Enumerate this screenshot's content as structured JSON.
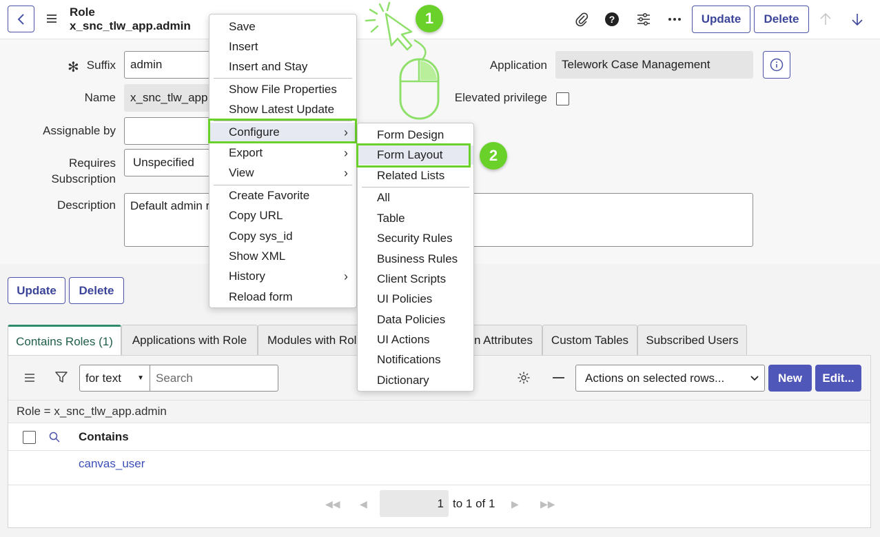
{
  "header": {
    "title": "Role",
    "subtitle": "x_snc_tlw_app.admin",
    "update_label": "Update",
    "delete_label": "Delete"
  },
  "form": {
    "suffix_label": "Suffix",
    "suffix_value": "admin",
    "name_label": "Name",
    "name_value": "x_snc_tlw_app.a",
    "assignable_label": "Assignable by",
    "requires_label_1": "Requires",
    "requires_label_2": "Subscription",
    "requires_value": "Unspecified",
    "description_label": "Description",
    "description_value": "Default admin r",
    "application_label": "Application",
    "application_value": "Telework Case Management",
    "elevated_label": "Elevated privilege",
    "update_label": "Update",
    "delete_label": "Delete"
  },
  "tabs": [
    {
      "label": "Contains Roles (1)"
    },
    {
      "label": "Applications with Role"
    },
    {
      "label": "Modules with Rol"
    },
    {
      "label": "n Attributes"
    },
    {
      "label": "Custom Tables"
    },
    {
      "label": "Subscribed Users"
    }
  ],
  "list": {
    "search_field": "for text",
    "search_placeholder": "Search",
    "actions_select": "Actions on selected rows...",
    "new_label": "New",
    "edit_label": "Edit...",
    "filter_text": "Role = x_snc_tlw_app.admin",
    "column_header": "Contains",
    "rows": [
      {
        "value": "canvas_user"
      }
    ],
    "page_current": "1",
    "page_range": "to 1 of 1"
  },
  "context_menu": {
    "items": [
      {
        "label": "Save"
      },
      {
        "label": "Insert"
      },
      {
        "label": "Insert and Stay"
      },
      {
        "label": "Show File Properties"
      },
      {
        "label": "Show Latest Update"
      },
      {
        "label": "Configure"
      },
      {
        "label": "Export"
      },
      {
        "label": "View"
      },
      {
        "label": "Create Favorite"
      },
      {
        "label": "Copy URL"
      },
      {
        "label": "Copy sys_id"
      },
      {
        "label": "Show XML"
      },
      {
        "label": "History"
      },
      {
        "label": "Reload form"
      }
    ]
  },
  "submenu": {
    "items": [
      {
        "label": "Form Design"
      },
      {
        "label": "Form Layout"
      },
      {
        "label": "Related Lists"
      },
      {
        "label": "All"
      },
      {
        "label": "Table"
      },
      {
        "label": "Security Rules"
      },
      {
        "label": "Business Rules"
      },
      {
        "label": "Client Scripts"
      },
      {
        "label": "UI Policies"
      },
      {
        "label": "Data Policies"
      },
      {
        "label": "UI Actions"
      },
      {
        "label": "Notifications"
      },
      {
        "label": "Dictionary"
      }
    ]
  },
  "annotations": {
    "step1": "1",
    "step2": "2",
    "highlight_color": "#6ad12a"
  },
  "colors": {
    "accent": "#4a53a8",
    "primary_button": "#4f57b8",
    "link": "#3c4fb8"
  }
}
